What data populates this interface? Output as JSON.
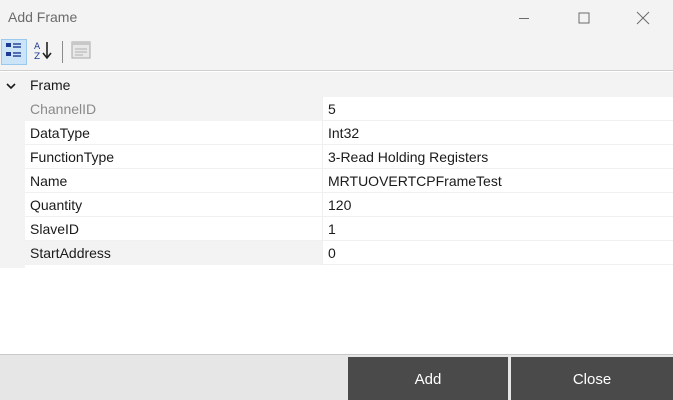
{
  "window": {
    "title": "Add Frame",
    "minimize_icon": "minimize-icon",
    "maximize_icon": "maximize-icon",
    "close_icon": "close-icon"
  },
  "toolbar": {
    "categorized_icon": "categorized-view-icon",
    "alphabetical_icon": "sort-alphabetical-icon",
    "property_pages_icon": "property-pages-icon"
  },
  "grid": {
    "category": "Frame",
    "properties": [
      {
        "name": "ChannelID",
        "value": "5",
        "readonly": true
      },
      {
        "name": "DataType",
        "value": "Int32",
        "readonly": false
      },
      {
        "name": "FunctionType",
        "value": "3-Read Holding Registers",
        "readonly": false
      },
      {
        "name": "Name",
        "value": "MRTUOVERTCPFrameTest",
        "readonly": false
      },
      {
        "name": "Quantity",
        "value": "120",
        "readonly": false
      },
      {
        "name": "SlaveID",
        "value": "1",
        "readonly": false
      },
      {
        "name": "StartAddress",
        "value": "0",
        "readonly": false
      }
    ]
  },
  "actions": {
    "add_label": "Add",
    "close_label": "Close"
  },
  "colors": {
    "button_bg": "#4a4a4a",
    "chrome_bg": "#f3f3f3",
    "active_toggle": "#cce4f7"
  }
}
